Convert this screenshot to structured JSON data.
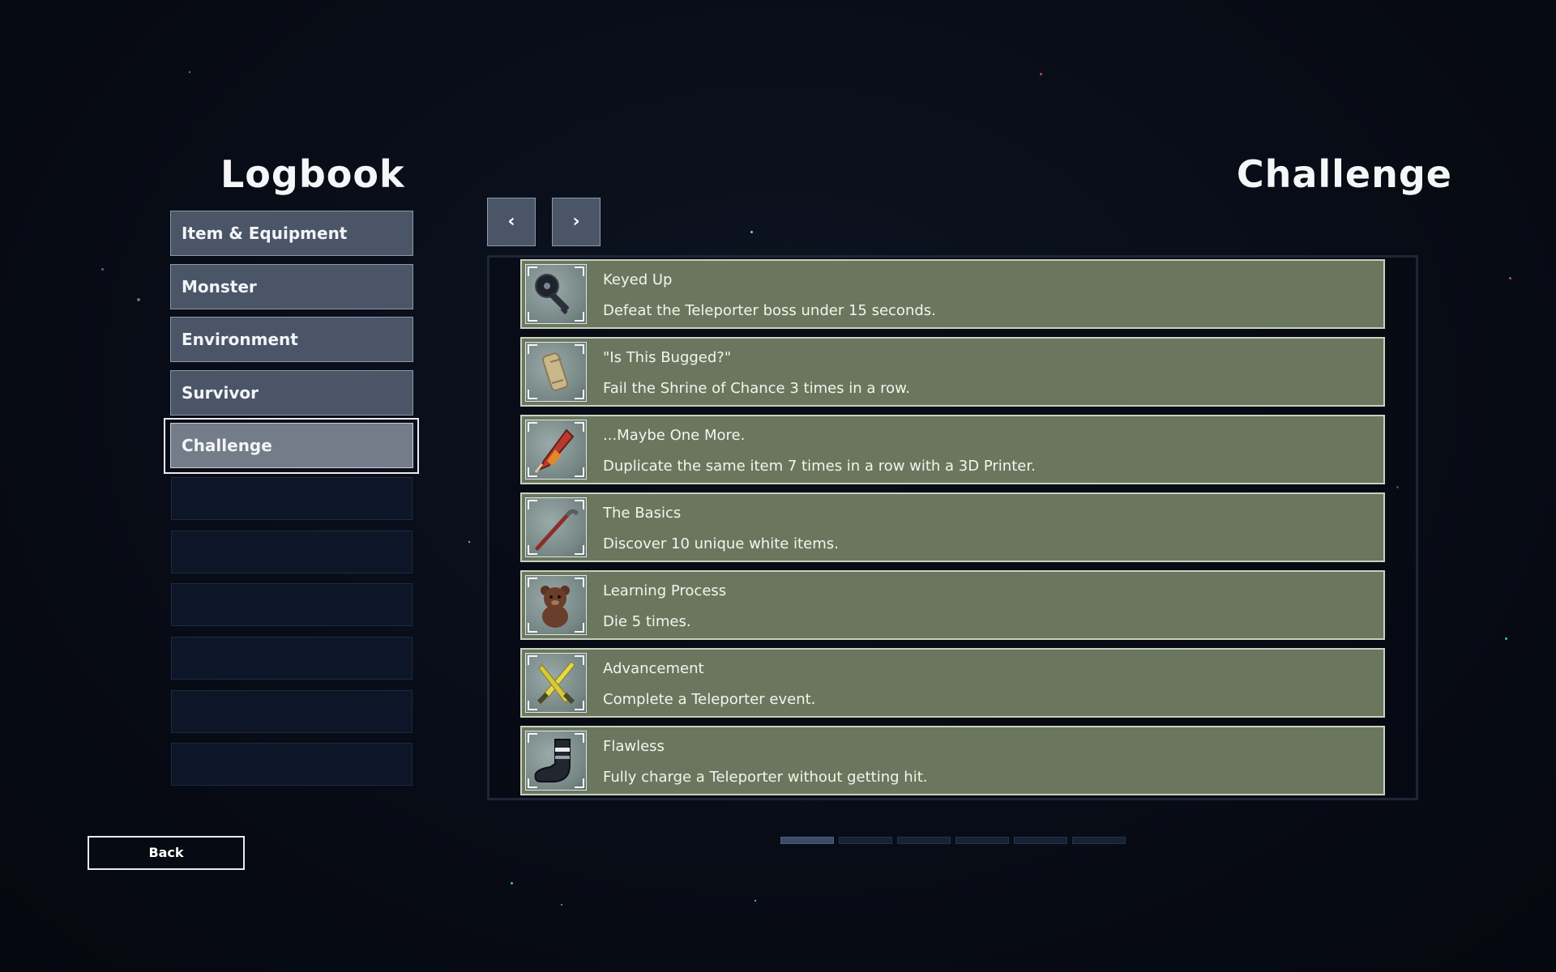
{
  "logbook_title": "Logbook",
  "section_title": "Challenge",
  "categories": [
    {
      "label": "Item & Equipment"
    },
    {
      "label": "Monster"
    },
    {
      "label": "Environment"
    },
    {
      "label": "Survivor"
    },
    {
      "label": "Challenge"
    }
  ],
  "selected_category": "Challenge",
  "nav": {
    "prev_label": "‹",
    "next_label": "›"
  },
  "challenges": [
    {
      "name": "Keyed Up",
      "description": "Defeat the Teleporter boss under 15 seconds.",
      "icon": "key-icon"
    },
    {
      "name": "\"Is This Bugged?\"",
      "description": "Fail the Shrine of Chance 3 times in a row.",
      "icon": "scroll-icon"
    },
    {
      "name": "...Maybe One More.",
      "description": "Duplicate the same item 7 times in a row with a 3D Printer.",
      "icon": "firework-icon"
    },
    {
      "name": "The Basics",
      "description": "Discover 10 unique white items.",
      "icon": "crowbar-icon"
    },
    {
      "name": "Learning Process",
      "description": "Die 5 times.",
      "icon": "teddy-bear-icon"
    },
    {
      "name": "Advancement",
      "description": "Complete a Teleporter event.",
      "icon": "daggers-icon"
    },
    {
      "name": "Flawless",
      "description": "Fully charge a Teleporter without getting hit.",
      "icon": "sock-icon"
    }
  ],
  "pagination": {
    "total_pages": 6,
    "current_page": 1
  },
  "back_label": "Back",
  "colors": {
    "row_background": "#6a775e",
    "button_background": "#4a5668",
    "selected_button": "#737c88",
    "page_background": "#080c16"
  }
}
